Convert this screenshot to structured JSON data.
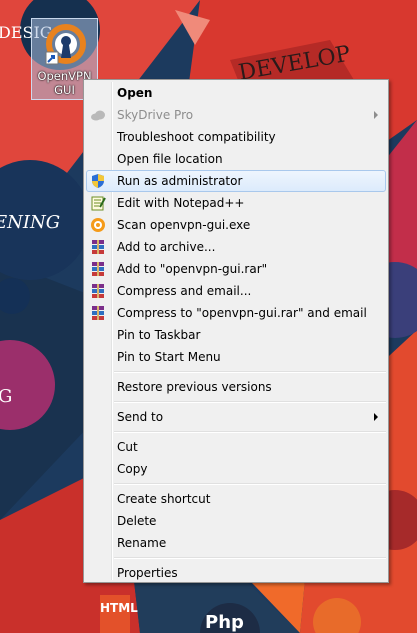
{
  "desktop": {
    "icon_label_line1": "OpenVPN",
    "icon_label_line2": "GUI"
  },
  "context_menu": {
    "open": "Open",
    "skydrive": "SkyDrive Pro",
    "troubleshoot": "Troubleshoot compatibility",
    "open_location": "Open file location",
    "run_admin": "Run as administrator",
    "edit_notepad": "Edit with Notepad++",
    "scan": "Scan openvpn-gui.exe",
    "add_archive": "Add to archive...",
    "add_rar": "Add to \"openvpn-gui.rar\"",
    "compress_email": "Compress and email...",
    "compress_rar_email": "Compress to \"openvpn-gui.rar\" and email",
    "pin_taskbar": "Pin to Taskbar",
    "pin_start": "Pin to Start Menu",
    "restore": "Restore previous versions",
    "send_to": "Send to",
    "cut": "Cut",
    "copy": "Copy",
    "create_shortcut": "Create shortcut",
    "delete": "Delete",
    "rename": "Rename",
    "properties": "Properties"
  },
  "colors": {
    "highlight_border": "#a9c8ec",
    "menu_bg": "#f0f0f0"
  }
}
